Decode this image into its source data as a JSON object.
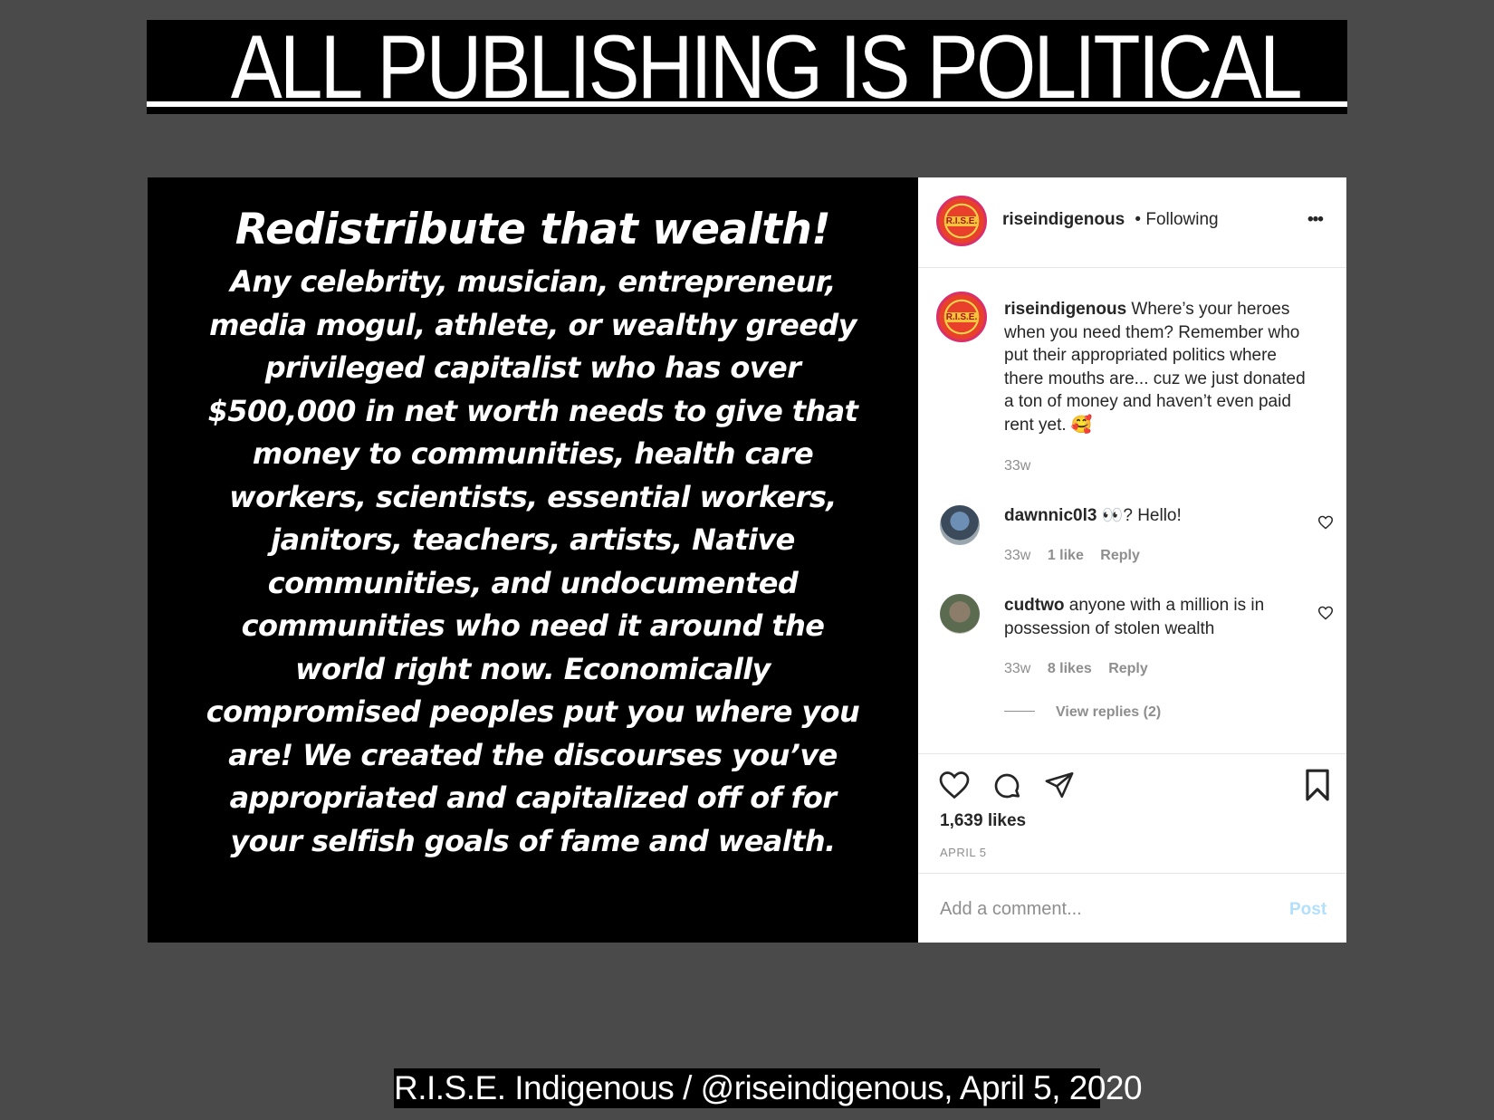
{
  "slide": {
    "title": "ALL PUBLISHING IS POLITICAL",
    "caption": "R.I.S.E. Indigenous / @riseindigenous, April 5, 2020"
  },
  "post_image": {
    "headline": "Redistribute that wealth!",
    "body_lines": [
      "Any celebrity, musician, entrepreneur,",
      "media mogul, athlete, or wealthy greedy",
      "privileged capitalist who has over",
      "$500,000 in net worth needs to give that",
      "money to communities, health care",
      "workers, scientists, essential workers,",
      "janitors, teachers, artists, Native",
      "communities, and undocumented",
      "communities who need it around the",
      "world right now. Economically",
      "compromised peoples  put you where you",
      "are! We created the discourses you’ve",
      "appropriated and capitalized off of for",
      "your selfish goals of fame and wealth."
    ]
  },
  "instagram": {
    "header": {
      "username": "riseindigenous",
      "follow_status": "• Following",
      "more": "•••",
      "avatar_text": "R.I.S.E."
    },
    "caption": {
      "username": "riseindigenous",
      "lines": [
        "Where’s your heroes",
        "when you need them? Remember who",
        "put their appropriated politics where",
        "there mouths are... cuz we just donated",
        "a ton of money and haven’t even paid",
        "rent yet. 🥰"
      ],
      "time": "33w"
    },
    "comments": [
      {
        "username": "dawnnic0l3",
        "text_lines": [
          "👀? Hello!"
        ],
        "time": "33w",
        "likes": "1 like",
        "reply": "Reply"
      },
      {
        "username": "cudtwo",
        "text_lines": [
          "anyone with a million is in",
          "possession of stolen wealth"
        ],
        "time": "33w",
        "likes": "8 likes",
        "reply": "Reply",
        "view_replies": "View replies (2)"
      }
    ],
    "likes_count": "1,639 likes",
    "date": "APRIL 5",
    "comment_placeholder": "Add a comment...",
    "post_button": "Post"
  },
  "icons": [
    "heart-icon",
    "comment-icon",
    "share-icon",
    "bookmark-icon",
    "more-icon"
  ]
}
